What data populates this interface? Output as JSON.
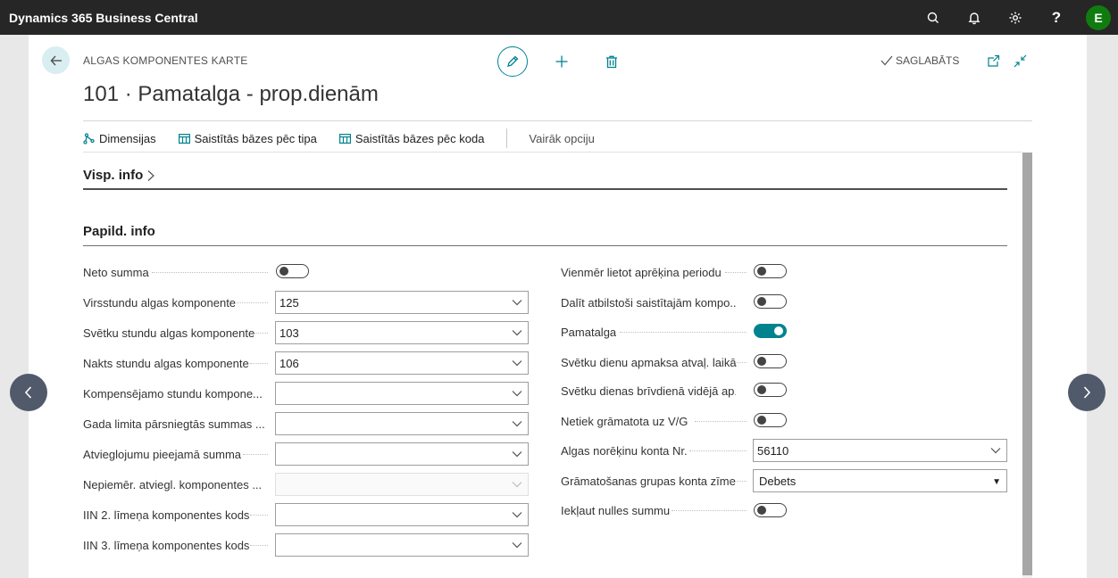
{
  "app": {
    "title": "Dynamics 365 Business Central",
    "user_initial": "E",
    "accent": "#00838f"
  },
  "topbar_icons": [
    "search-icon",
    "bell-icon",
    "gear-icon",
    "help-icon"
  ],
  "header": {
    "caption": "ALGAS KOMPONENTES KARTE",
    "title": "101 · Pamatalga - prop.dienām",
    "saved_label": "SAGLABĀTS"
  },
  "actions": {
    "dimensions": "Dimensijas",
    "linked_by_type": "Saistītās bāzes pēc tipa",
    "linked_by_code": "Saistītās bāzes pēc koda",
    "more": "Vairāk opciju"
  },
  "sections": {
    "general": "Visp. info",
    "additional": "Papild. info"
  },
  "left_fields": {
    "neto": {
      "label": "Neto summa",
      "on": false
    },
    "overtime": {
      "label": "Virsstundu algas komponente",
      "value": "125"
    },
    "holiday_hours": {
      "label": "Svētku stundu algas komponente",
      "value": "103"
    },
    "night_hours": {
      "label": "Nakts stundu algas komponente",
      "value": "106"
    },
    "comp_hours": {
      "label": "Kompensējamo stundu kompone...",
      "value": ""
    },
    "year_limit": {
      "label": "Gada limita pārsniegtās summas ...",
      "value": ""
    },
    "relief": {
      "label": "Atvieglojumu pieejamā summa",
      "value": ""
    },
    "non_relief": {
      "label": "Nepiemēr. atviegl. komponentes ...",
      "value": ""
    },
    "iin2": {
      "label": "IIN 2. līmeņa komponentes kods",
      "value": ""
    },
    "iin3": {
      "label": "IIN 3. līmeņa komponentes kods",
      "value": ""
    }
  },
  "right_fields": {
    "always_period": {
      "label": "Vienmēr lietot aprēķina periodu",
      "on": false
    },
    "split": {
      "label": "Dalīt atbilstoši saistītajām kompo...",
      "on": false
    },
    "base_salary": {
      "label": "Pamatalga",
      "on": true
    },
    "holiday_pay": {
      "label": "Svētku dienu apmaksa atvaļ. laikā",
      "on": false
    },
    "holiday_avg": {
      "label": "Svētku dienas brīvdienā vidējā ap...",
      "on": false
    },
    "not_posted": {
      "label": "Netiek grāmatota uz V/G",
      "on": false
    },
    "account": {
      "label": "Algas norēķinu konta Nr.",
      "value": "56110"
    },
    "posting_sign": {
      "label": "Grāmatošanas grupas konta zīme",
      "value": "Debets"
    },
    "include_zero": {
      "label": "Iekļaut nulles summu",
      "on": false
    }
  }
}
